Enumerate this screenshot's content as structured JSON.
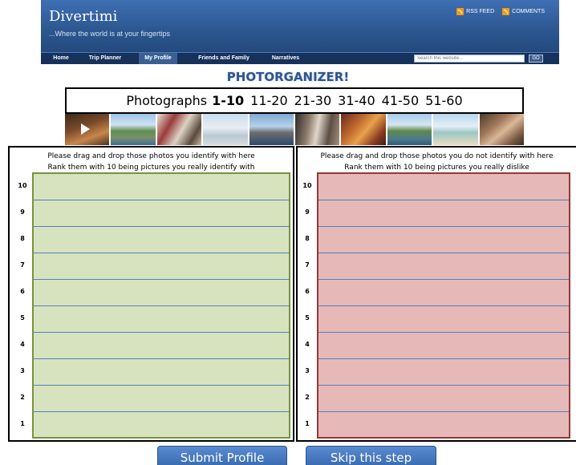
{
  "header": {
    "site_title": "Divertimi",
    "tagline": "...Where the world is at your fingertips",
    "feeds": [
      {
        "label": "RSS FEED",
        "icon": "rss-icon"
      },
      {
        "label": "COMMENTS",
        "icon": "rss-icon"
      }
    ]
  },
  "nav": {
    "items": [
      {
        "label": "Home",
        "active": false
      },
      {
        "label": "Trip Planner",
        "active": false
      },
      {
        "label": "My Profile",
        "active": true
      },
      {
        "label": "Friends and Family",
        "active": false
      },
      {
        "label": "Narratives",
        "active": false
      }
    ],
    "search_placeholder": "Search this website...",
    "go_label": "GO"
  },
  "page_title": "PHOTORGANIZER!",
  "pager": {
    "label": "Photographs",
    "pages": [
      "1-10",
      "11-20",
      "21-30",
      "31-40",
      "41-50",
      "51-60"
    ],
    "current": "1-10"
  },
  "thumbnails": [
    {
      "name": "photo-thumbnail-1",
      "icon": "play-icon"
    },
    {
      "name": "photo-thumbnail-2"
    },
    {
      "name": "photo-thumbnail-3"
    },
    {
      "name": "photo-thumbnail-4"
    },
    {
      "name": "photo-thumbnail-5"
    },
    {
      "name": "photo-thumbnail-6"
    },
    {
      "name": "photo-thumbnail-7"
    },
    {
      "name": "photo-thumbnail-8"
    },
    {
      "name": "photo-thumbnail-9"
    },
    {
      "name": "photo-thumbnail-10"
    }
  ],
  "identify_panel": {
    "line1": "Please drag and drop those photos you identify with  here",
    "line2": "Rank them with 10 being pictures you really identify with",
    "ranks": [
      "10",
      "9",
      "8",
      "7",
      "6",
      "5",
      "4",
      "3",
      "2",
      "1"
    ],
    "fill_color": "#d7e3bf",
    "border_color": "#77933c"
  },
  "dislike_panel": {
    "line1": "Please drag and drop those photos you do not identify  with here",
    "line2": "Rank them with 10 being pictures you really dislike",
    "ranks": [
      "10",
      "9",
      "8",
      "7",
      "6",
      "5",
      "4",
      "3",
      "2",
      "1"
    ],
    "fill_color": "#e6b9b8",
    "border_color": "#953735"
  },
  "buttons": {
    "submit": "Submit Profile",
    "skip": "Skip this step"
  },
  "colors": {
    "header_blue": "#2b568f",
    "nav_dark": "#16315a",
    "title_blue": "#2e5590",
    "button_blue": "#3b6db3"
  }
}
